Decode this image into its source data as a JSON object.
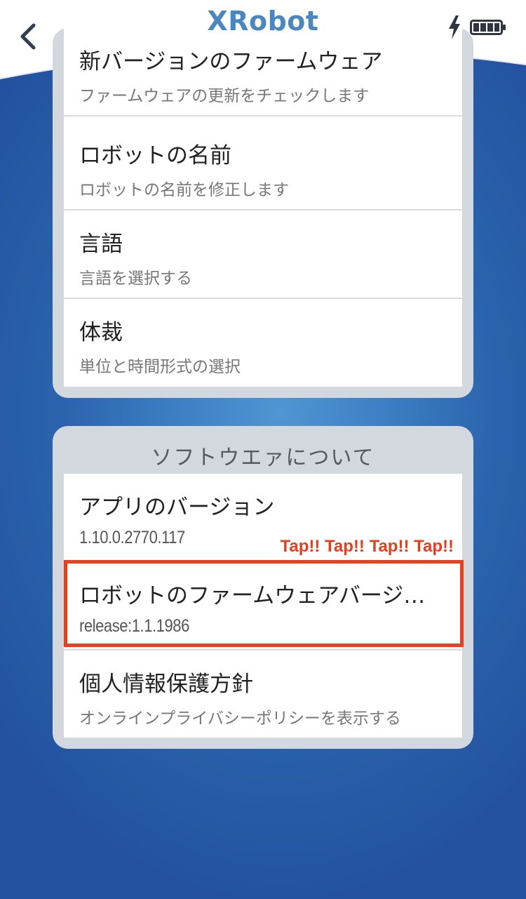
{
  "header": {
    "title": "XRobot"
  },
  "icons": {
    "back": "chevron-left-icon",
    "charging": "lightning-icon",
    "battery": "battery-icon"
  },
  "settings": {
    "items": [
      {
        "title": "新バージョンのファームウェア",
        "subtitle": "ファームウェアの更新をチェックします"
      },
      {
        "title": "ロボットの名前",
        "subtitle": "ロボットの名前を修正します"
      },
      {
        "title": "言語",
        "subtitle": "言語を選択する"
      },
      {
        "title": "体裁",
        "subtitle": "単位と時間形式の選択"
      }
    ]
  },
  "about": {
    "section_title": "ソフトウエァについて",
    "items": [
      {
        "title": "アプリのバージョン",
        "subtitle": "1.10.0.2770.117"
      },
      {
        "title": "ロボットのファームウェアバージョン",
        "subtitle": "release:1.1.1986"
      },
      {
        "title": "個人情報保護方針",
        "subtitle": "オンラインプライバシーポリシーを表示する"
      }
    ]
  },
  "annotation": {
    "tap_text": "Tap!! Tap!! Tap!! Tap!!",
    "highlight_color": "#e8401c"
  },
  "colors": {
    "title": "#4a86c0",
    "background": "#2a63ad",
    "card_frame": "#d3d8de"
  }
}
